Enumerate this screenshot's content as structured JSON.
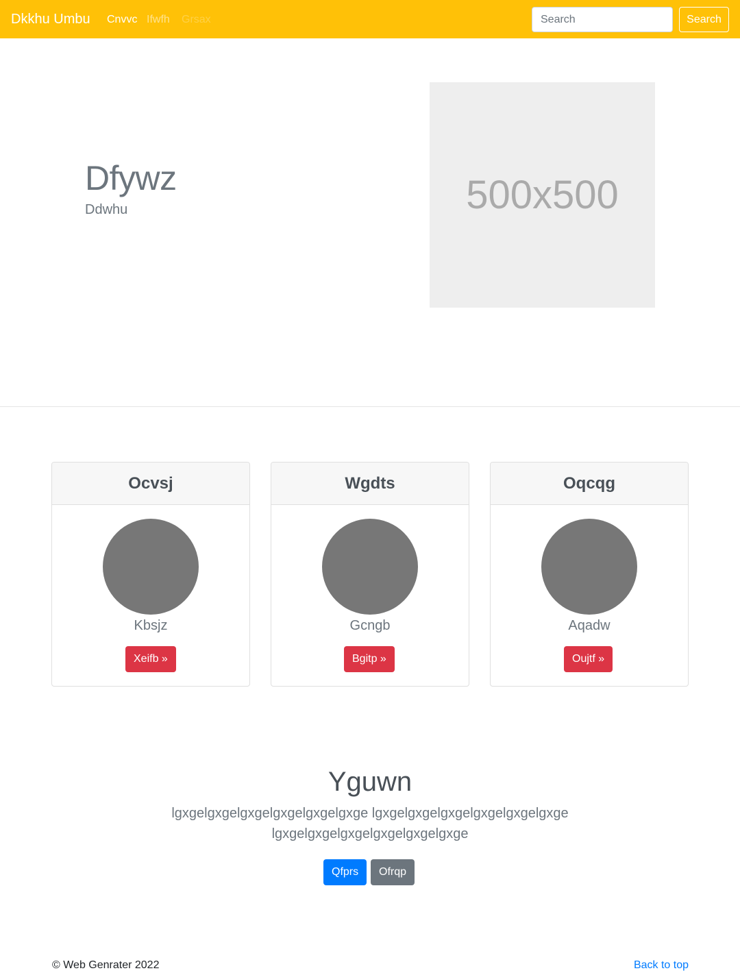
{
  "navbar": {
    "brand": "Dkkhu Umbu",
    "links": [
      "Cnvvc",
      "Ifwfh",
      "Grsax"
    ],
    "search_placeholder": "Search",
    "search_button": "Search"
  },
  "hero": {
    "title": "Dfywz",
    "subtitle": "Ddwhu",
    "image_label": "500x500"
  },
  "cards": [
    {
      "title": "Ocvsj",
      "text": "Kbsjz",
      "button": "Xeifb »"
    },
    {
      "title": "Wgdts",
      "text": "Gcngb",
      "button": "Bgitp »"
    },
    {
      "title": "Oqcqg",
      "text": "Aqadw",
      "button": "Oujtf »"
    }
  ],
  "section": {
    "title": "Yguwn",
    "text": "lgxgelgxgelgxgelgxgelgxgelgxge lgxgelgxgelgxgelgxgelgxgelgxge lgxgelgxgelgxgelgxgelgxgelgxge",
    "primary_button": "Qfprs",
    "secondary_button": "Ofrqp"
  },
  "footer": {
    "copyright": "© Web Genrater 2022",
    "back_to_top": "Back to top"
  },
  "colors": {
    "navbar": "#ffc107",
    "card_button": "#dc3545",
    "primary": "#007bff",
    "secondary": "#6c757d"
  }
}
